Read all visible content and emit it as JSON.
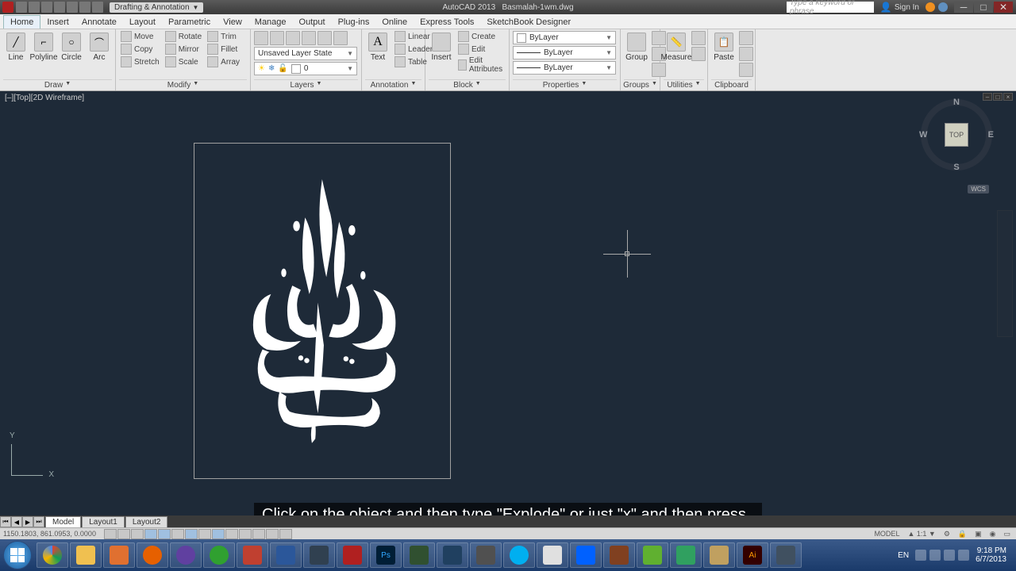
{
  "title": {
    "app_name": "AutoCAD 2013",
    "file_name": "Basmalah-1wm.dwg",
    "workspace": "Drafting & Annotation",
    "search_placeholder": "Type a keyword or phrase",
    "signin": "Sign In"
  },
  "ribbon": {
    "tabs": [
      "Home",
      "Insert",
      "Annotate",
      "Layout",
      "Parametric",
      "View",
      "Manage",
      "Output",
      "Plug-ins",
      "Online",
      "Express Tools",
      "SketchBook Designer"
    ],
    "active_tab": "Home",
    "draw": {
      "label": "Draw",
      "line": "Line",
      "polyline": "Polyline",
      "circle": "Circle",
      "arc": "Arc"
    },
    "modify": {
      "label": "Modify",
      "move": "Move",
      "rotate": "Rotate",
      "trim": "Trim",
      "copy": "Copy",
      "mirror": "Mirror",
      "fillet": "Fillet",
      "stretch": "Stretch",
      "scale": "Scale",
      "array": "Array"
    },
    "layers": {
      "label": "Layers",
      "state": "Unsaved Layer State",
      "current": "0"
    },
    "annotation": {
      "label": "Annotation",
      "text": "Text",
      "linear": "Linear",
      "leader": "Leader",
      "table": "Table"
    },
    "block": {
      "label": "Block",
      "insert": "Insert",
      "create": "Create",
      "edit": "Edit",
      "edit_attr": "Edit Attributes"
    },
    "properties": {
      "label": "Properties",
      "layer": "ByLayer",
      "lw": "ByLayer",
      "lt": "ByLayer"
    },
    "groups": {
      "label": "Groups",
      "group": "Group"
    },
    "utilities": {
      "label": "Utilities",
      "measure": "Measure"
    },
    "clipboard": {
      "label": "Clipboard",
      "paste": "Paste"
    }
  },
  "viewport": {
    "label": "[–][Top][2D Wireframe]",
    "viewcube_face": "TOP",
    "wcs": "WCS",
    "n": "N",
    "s": "S",
    "e": "E",
    "w": "W",
    "ucs_y": "Y",
    "ucs_x": "X"
  },
  "caption": "Click on the object and then type \"Explode\" or just \"x\" and then press Enter",
  "layout_tabs": {
    "model": "Model",
    "l1": "Layout1",
    "l2": "Layout2"
  },
  "status": {
    "coords": "1150.1803, 861.0953, 0.0000",
    "model": "MODEL",
    "scale": "1:1",
    "lang": "EN"
  },
  "tray": {
    "time": "9:18 PM",
    "date": "6/7/2013"
  }
}
